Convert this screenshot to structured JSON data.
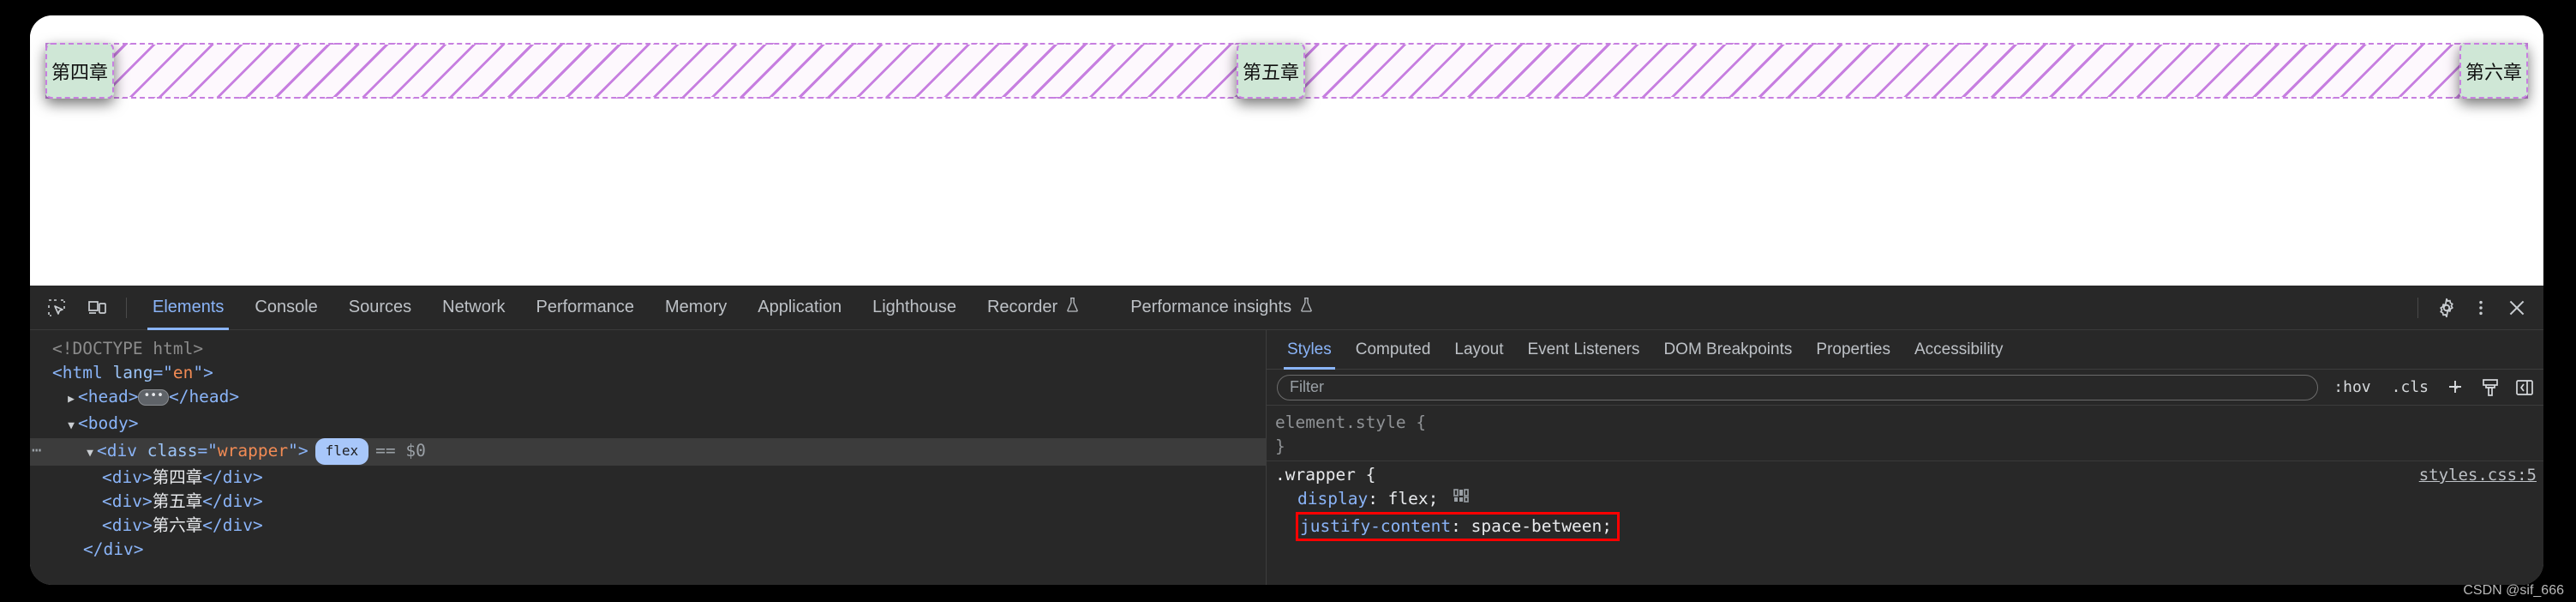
{
  "page": {
    "chapters": [
      "第四章",
      "第五章",
      "第六章"
    ]
  },
  "devtools": {
    "toolbar": {
      "icons": [
        {
          "name": "inspect-element-icon"
        },
        {
          "name": "device-toolbar-icon"
        }
      ],
      "tabs": [
        {
          "label": "Elements",
          "active": true
        },
        {
          "label": "Console",
          "active": false
        },
        {
          "label": "Sources",
          "active": false
        },
        {
          "label": "Network",
          "active": false
        },
        {
          "label": "Performance",
          "active": false
        },
        {
          "label": "Memory",
          "active": false
        },
        {
          "label": "Application",
          "active": false
        },
        {
          "label": "Lighthouse",
          "active": false
        },
        {
          "label": "Recorder",
          "active": false,
          "experiment": true
        },
        {
          "label": "Performance insights",
          "active": false,
          "experiment": true
        }
      ],
      "right_icons": [
        {
          "name": "settings-gear-icon"
        },
        {
          "name": "more-options-icon"
        },
        {
          "name": "close-devtools-icon"
        }
      ]
    },
    "dom": {
      "lines": [
        {
          "indent": 0,
          "type": "doctype",
          "text": "<!DOCTYPE html>"
        },
        {
          "indent": 0,
          "type": "open",
          "tag": "html",
          "attr_name": "lang",
          "attr_value": "en"
        },
        {
          "indent": 1,
          "type": "collapsed",
          "tag": "head",
          "arrow": "▶"
        },
        {
          "indent": 1,
          "type": "open-simple",
          "tag": "body",
          "arrow": "▼"
        },
        {
          "indent": 2,
          "type": "selected",
          "tag": "div",
          "attr_name": "class",
          "attr_value": "wrapper",
          "arrow": "▼",
          "badge": "flex",
          "suffix": "== $0",
          "dots": "⋯"
        },
        {
          "indent": 3,
          "type": "text-node",
          "tag": "div",
          "text": "第四章"
        },
        {
          "indent": 3,
          "type": "text-node",
          "tag": "div",
          "text": "第五章"
        },
        {
          "indent": 3,
          "type": "text-node",
          "tag": "div",
          "text": "第六章"
        },
        {
          "indent": 2,
          "type": "close",
          "tag": "div"
        }
      ]
    },
    "styles": {
      "tabs": [
        {
          "label": "Styles",
          "active": true
        },
        {
          "label": "Computed",
          "active": false
        },
        {
          "label": "Layout",
          "active": false
        },
        {
          "label": "Event Listeners",
          "active": false
        },
        {
          "label": "DOM Breakpoints",
          "active": false
        },
        {
          "label": "Properties",
          "active": false
        },
        {
          "label": "Accessibility",
          "active": false
        }
      ],
      "filter_placeholder": "Filter",
      "toolbar_buttons": [
        {
          "label": ":hov",
          "name": "toggle-element-state-button"
        },
        {
          "label": ".cls",
          "name": "toggle-class-button"
        },
        {
          "label": "+",
          "name": "new-style-rule-button"
        },
        {
          "label": "brush",
          "name": "computed-styles-brush-icon"
        },
        {
          "label": "sidebar",
          "name": "toggle-sidebar-icon"
        }
      ],
      "rules": [
        {
          "selector": "element.style",
          "open_brace": "{",
          "close_brace": "}",
          "source": "",
          "declarations": []
        },
        {
          "selector": ".wrapper",
          "open_brace": "{",
          "close_brace": "}",
          "source": "styles.css:5",
          "declarations": [
            {
              "property": "display",
              "value": "flex",
              "highlighted": false,
              "flex_icon": true
            },
            {
              "property": "justify-content",
              "value": "space-between",
              "highlighted": true,
              "flex_icon": false
            }
          ]
        }
      ]
    }
  },
  "watermark": "CSDN @sif_666"
}
